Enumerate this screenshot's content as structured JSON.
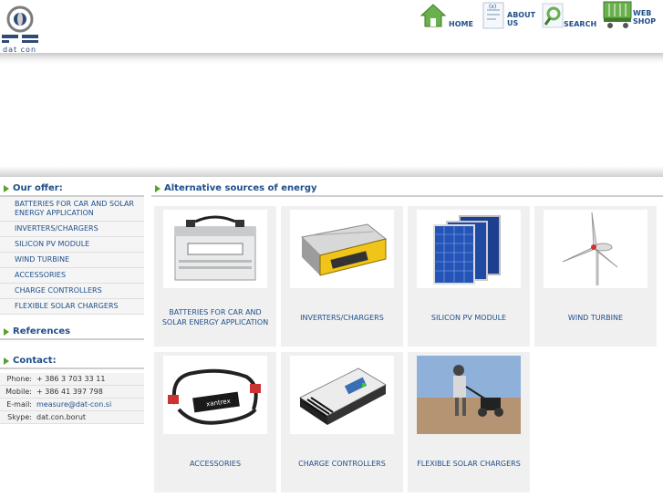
{
  "brand": {
    "logo_text": "dat con"
  },
  "nav": {
    "home": "HOME",
    "about_line1": "ABOUT",
    "about_line2": "US",
    "search": "SEARCH",
    "webshop_line1": "WEB",
    "webshop_line2": "SHOP"
  },
  "sidebar": {
    "offer_heading": "Our offer:",
    "offer_items": [
      "BATTERIES FOR CAR AND SOLAR ENERGY APPLICATION",
      "INVERTERS/CHARGERS",
      "SILICON PV MODULE",
      "WIND TURBINE",
      "ACCESSORIES",
      "CHARGE CONTROLLERS",
      "FLEXIBLE SOLAR CHARGERS"
    ],
    "references_heading": "References",
    "contact_heading": "Contact:",
    "contact": [
      {
        "label": "Phone:",
        "value": "+ 386 3 703 33 11"
      },
      {
        "label": "Mobile:",
        "value": "+ 386 41 397 798"
      },
      {
        "label": "E-mail:",
        "value": "measure@dat-con.si"
      },
      {
        "label": "Skype:",
        "value": "dat.con.borut"
      }
    ]
  },
  "main": {
    "heading": "Alternative sources of energy",
    "products": [
      {
        "caption": "BATTERIES FOR CAR AND SOLAR ENERGY APPLICATION"
      },
      {
        "caption": "INVERTERS/CHARGERS"
      },
      {
        "caption": "SILICON PV MODULE"
      },
      {
        "caption": "WIND TURBINE"
      },
      {
        "caption": "ACCESSORIES"
      },
      {
        "caption": "CHARGE CONTROLLERS"
      },
      {
        "caption": "FLEXIBLE SOLAR CHARGERS"
      }
    ]
  },
  "colors": {
    "link": "#1f4f8a",
    "accent": "#5aa02c",
    "card_bg": "#f0f0f0"
  }
}
